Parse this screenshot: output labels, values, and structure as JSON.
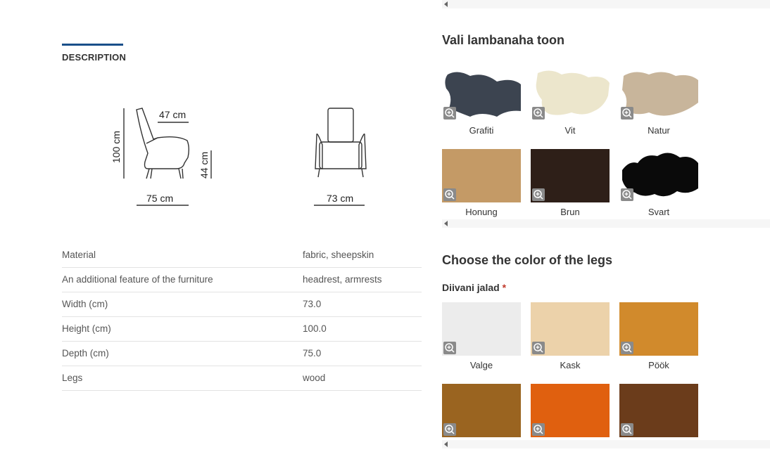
{
  "tabs": {
    "description": "DESCRIPTION"
  },
  "diagram": {
    "height": "100 cm",
    "top_width": "47 cm",
    "seat_height": "44 cm",
    "depth": "75 cm",
    "front_width": "73 cm"
  },
  "specs": [
    {
      "label": "Material",
      "value": "fabric, sheepskin"
    },
    {
      "label": "An additional feature of the furniture",
      "value": "headrest, armrests"
    },
    {
      "label": "Width (cm)",
      "value": "73.0"
    },
    {
      "label": "Height (cm)",
      "value": "100.0"
    },
    {
      "label": "Depth (cm)",
      "value": "75.0"
    },
    {
      "label": "Legs",
      "value": "wood"
    }
  ],
  "sheepskin": {
    "title": "Vali lambanaha toon",
    "options": [
      {
        "name": "Grafiti",
        "color": "#3c4450"
      },
      {
        "name": "Vit",
        "color": "#ece6cc"
      },
      {
        "name": "Natur",
        "color": "#c8b59b"
      },
      {
        "name": "Honung",
        "color": "#c49a66"
      },
      {
        "name": "Brun",
        "color": "#2e1f18"
      },
      {
        "name": "Svart",
        "color": "#0a0a0a"
      }
    ]
  },
  "legs": {
    "title": "Choose the color of the legs",
    "field_label": "Diivani jalad",
    "required_mark": "*",
    "options": [
      {
        "name": "Valge",
        "color": "#ececec"
      },
      {
        "name": "Kask",
        "color": "#ecd2aa"
      },
      {
        "name": "Pöök",
        "color": "#d18a2c"
      },
      {
        "name": "",
        "color": "#9a6420"
      },
      {
        "name": "",
        "color": "#e0600f"
      },
      {
        "name": "",
        "color": "#6b3c1b"
      }
    ]
  }
}
